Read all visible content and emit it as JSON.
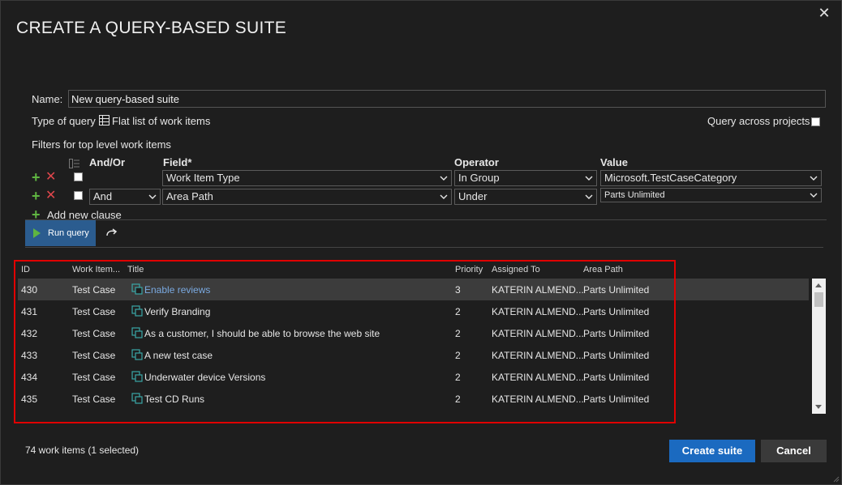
{
  "dialog": {
    "title": "CREATE A QUERY-BASED SUITE",
    "close_glyph": "✕"
  },
  "form": {
    "name_label": "Name:",
    "name_value": "New query-based suite",
    "type_label": "Type of query",
    "type_value": "Flat list of work items",
    "type_icon": "list-grid-icon",
    "cross_projects_label": "Query across projects",
    "filters_label": "Filters for top level work items"
  },
  "clauses": {
    "headers": {
      "andor": "And/Or",
      "field": "Field*",
      "operator": "Operator",
      "value": "Value"
    },
    "rows": [
      {
        "andor": "",
        "field": "Work Item Type",
        "operator": "In Group",
        "value": "Microsoft.TestCaseCategory"
      },
      {
        "andor": "And",
        "field": "Area Path",
        "operator": "Under",
        "value": "Parts Unlimited"
      }
    ],
    "add_label": "Add new clause"
  },
  "toolbar": {
    "run_label": "Run query"
  },
  "grid": {
    "columns": [
      "ID",
      "Work Item...",
      "Title",
      "Priority",
      "Assigned To",
      "Area Path"
    ],
    "rows": [
      {
        "id": "430",
        "type": "Test Case",
        "title": "Enable reviews",
        "priority": "3",
        "assigned": "KATERIN ALMEND...",
        "area": "Parts Unlimited"
      },
      {
        "id": "431",
        "type": "Test Case",
        "title": "Verify Branding",
        "priority": "2",
        "assigned": "KATERIN ALMEND...",
        "area": "Parts Unlimited"
      },
      {
        "id": "432",
        "type": "Test Case",
        "title": "As a customer, I should be able to browse the web site",
        "priority": "2",
        "assigned": "KATERIN ALMEND...",
        "area": "Parts Unlimited"
      },
      {
        "id": "433",
        "type": "Test Case",
        "title": "A new test case",
        "priority": "2",
        "assigned": "KATERIN ALMEND...",
        "area": "Parts Unlimited"
      },
      {
        "id": "434",
        "type": "Test Case",
        "title": "Underwater device Versions",
        "priority": "2",
        "assigned": "KATERIN ALMEND...",
        "area": "Parts Unlimited"
      },
      {
        "id": "435",
        "type": "Test Case",
        "title": "Test CD Runs",
        "priority": "2",
        "assigned": "KATERIN ALMEND...",
        "area": "Parts Unlimited"
      }
    ]
  },
  "footer": {
    "count_text": "74 work items (1 selected)",
    "create_label": "Create suite",
    "cancel_label": "Cancel"
  },
  "colors": {
    "accent": "#1b6ac0",
    "run_button": "#2b5c8f",
    "highlight_box": "#e00000",
    "add_green": "#5fb541",
    "remove_red": "#e0474c",
    "link": "#7aa9e0"
  }
}
